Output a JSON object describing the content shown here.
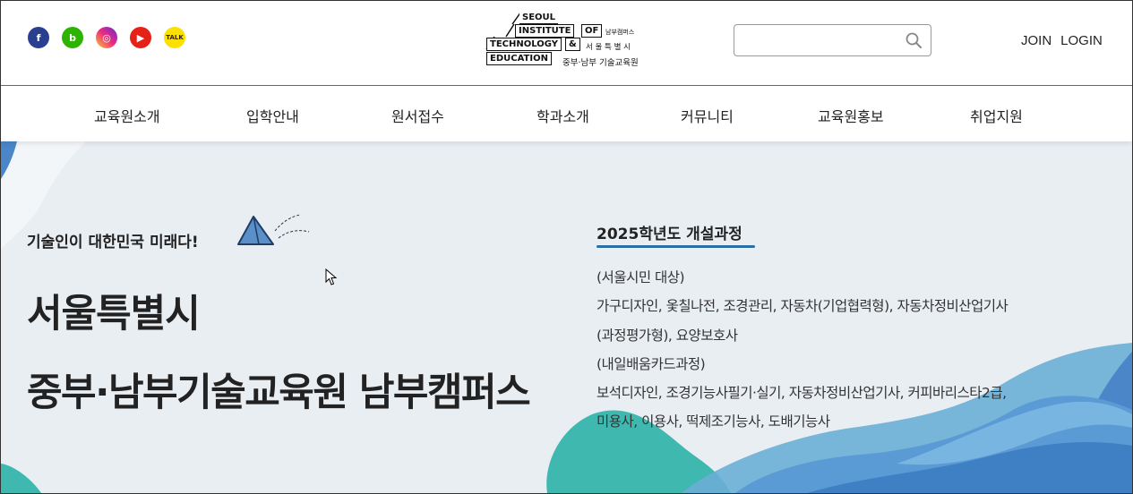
{
  "social": [
    {
      "name": "facebook",
      "glyph": "f",
      "icon": "facebook-icon"
    },
    {
      "name": "blog",
      "glyph": "b",
      "icon": "naver-blog-icon"
    },
    {
      "name": "instagram",
      "glyph": "◎",
      "icon": "instagram-icon"
    },
    {
      "name": "youtube",
      "glyph": "▶",
      "icon": "youtube-icon"
    },
    {
      "name": "kakaotalk",
      "glyph": "TALK",
      "icon": "kakaotalk-icon"
    }
  ],
  "logo": {
    "line1": "SEOUL",
    "line2": "INSTITUTE",
    "line2b": "OF",
    "line3": "TECHNOLOGY",
    "line3b": "&",
    "line4": "EDUCATION",
    "sub1": "남부캠퍼스",
    "sub2": "서 울 특 별 시",
    "sub3": "중부·남부 기술교육원"
  },
  "search": {
    "placeholder": "",
    "value": ""
  },
  "auth": {
    "join": "JOIN",
    "login": "LOGIN"
  },
  "nav": [
    "교육원소개",
    "입학안내",
    "원서접수",
    "학과소개",
    "커뮤니티",
    "교육원홍보",
    "취업지원"
  ],
  "hero": {
    "tagline": "기술인이 대한민국 미래다!",
    "title_line1": "서울특별시",
    "title_line2": "중부·남부기술교육원 남부캠퍼스"
  },
  "courses": {
    "heading": "2025학년도 개설과정",
    "lines": [
      "(서울시민 대상)",
      "가구디자인, 옻칠나전, 조경관리, 자동차(기업협력형), 자동차정비산업기사",
      "(과정평가형), 요양보호사",
      "(내일배움카드과정)",
      "보석디자인, 조경기능사필기·실기, 자동차정비산업기사, 커피바리스타2급,",
      "미용사, 이용사, 떡제조기능사, 도배기능사"
    ]
  },
  "colors": {
    "accent": "#2f6ea3",
    "hero_bg": "#e9eef3",
    "wave_blue": "#4a86c8",
    "wave_teal": "#3fb8b0"
  }
}
